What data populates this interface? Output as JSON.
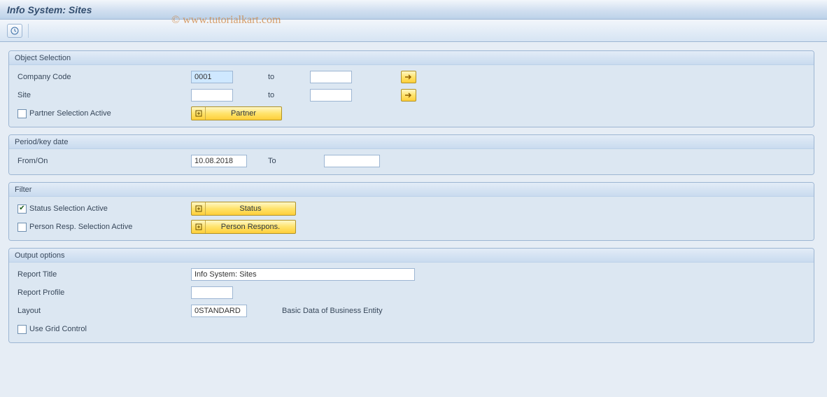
{
  "header": {
    "title": "Info System: Sites"
  },
  "watermark": "© www.tutorialkart.com",
  "groups": {
    "object_selection": {
      "title": "Object Selection",
      "company_code": {
        "label": "Company Code",
        "from_value": "0001",
        "to_label": "to",
        "to_value": ""
      },
      "site": {
        "label": "Site",
        "from_value": "",
        "to_label": "to",
        "to_value": ""
      },
      "partner_check_label": "Partner Selection Active",
      "partner_btn": "Partner"
    },
    "period": {
      "title": "Period/key date",
      "from_label": "From/On",
      "from_value": "10.08.2018",
      "to_label": "To",
      "to_value": ""
    },
    "filter": {
      "title": "Filter",
      "status_check_label": "Status Selection Active",
      "status_btn": "Status",
      "person_check_label": "Person Resp. Selection Active",
      "person_btn": "Person Respons."
    },
    "output": {
      "title": "Output options",
      "report_title_label": "Report Title",
      "report_title_value": "Info System: Sites",
      "report_profile_label": "Report Profile",
      "report_profile_value": "",
      "layout_label": "Layout",
      "layout_value": "0STANDARD",
      "layout_desc": "Basic Data of Business Entity",
      "grid_label": "Use Grid Control"
    }
  }
}
